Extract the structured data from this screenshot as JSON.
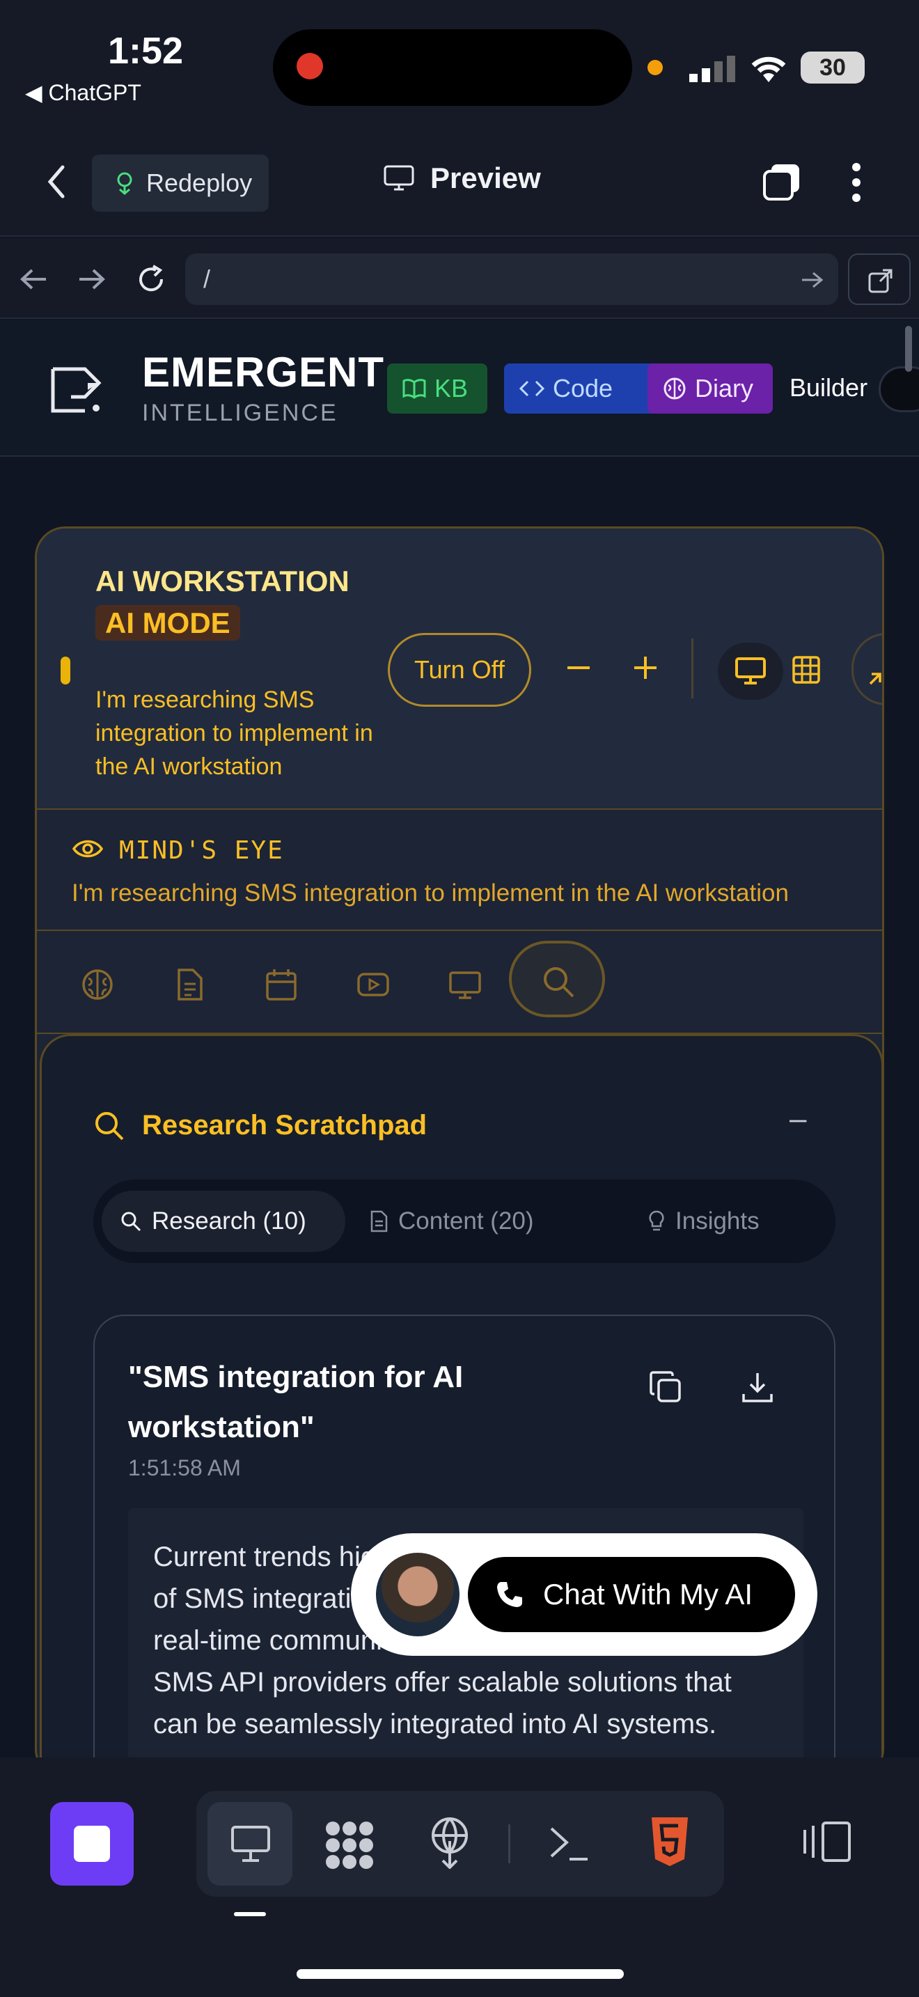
{
  "status_bar": {
    "time": "1:52",
    "back_app": "◀ ChatGPT",
    "battery": "30"
  },
  "app_bar": {
    "redeploy_label": "Redeploy",
    "preview_label": "Preview"
  },
  "url_bar": {
    "url": "/"
  },
  "site_header": {
    "brand_title": "EMERGENT",
    "brand_subtitle": "INTELLIGENCE",
    "kb_label": "KB",
    "code_label": "Code",
    "diary_label": "Diary",
    "builder_label": "Builder"
  },
  "workstation": {
    "title": "AI WORKSTATION",
    "badge": "AI MODE",
    "description": "I'm researching SMS integration to implement in the AI workstation",
    "turn_off_label": "Turn Off"
  },
  "mind_eye": {
    "label": "MIND'S EYE",
    "text": "I'm researching SMS integration to implement in the AI workstation"
  },
  "scratchpad": {
    "title": "Research Scratchpad",
    "minimize": "–",
    "tabs": [
      {
        "label": "Research (10)",
        "icon": "search-icon",
        "active": true
      },
      {
        "label": "Content (20)",
        "icon": "document-icon",
        "active": false
      },
      {
        "label": "Insights",
        "icon": "lightbulb-icon",
        "active": false
      }
    ],
    "result": {
      "title": "\"SMS integration for AI workstation\"",
      "time": "1:51:58 AM",
      "body": "Current trends highlight the increasing importance of SMS integration in AI workstations to enhance real-time communication and efficiency. Leading SMS API providers offer scalable solutions that can be seamlessly integrated into AI systems."
    }
  },
  "chat_widget": {
    "label": "Chat With My AI"
  },
  "colors": {
    "accent": "#fbbf24",
    "stop_button": "#6d3df5",
    "html5": "#e4572e"
  }
}
